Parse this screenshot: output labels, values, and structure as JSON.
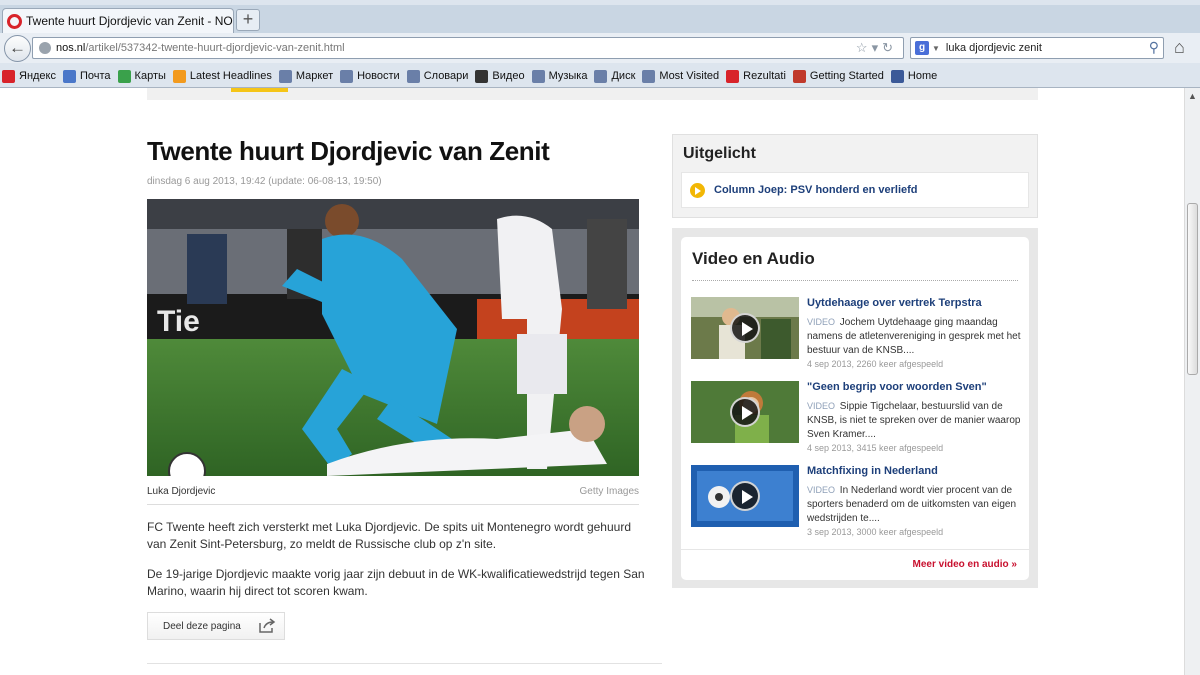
{
  "browser": {
    "tab_title": "Twente huurt Djordjevic van Zenit - NOS Sport",
    "new_tab": "+",
    "url_domain": "nos.nl",
    "url_path": "/artikel/537342-twente-huurt-djordjevic-van-zenit.html",
    "search_engine": "g",
    "search_query": "luka djordjevic zenit",
    "bookmarks": [
      {
        "label": "Яндекс",
        "icon": "yandex-icon",
        "color": "#d8232a"
      },
      {
        "label": "Почта",
        "icon": "mail-icon",
        "color": "#4a77c9"
      },
      {
        "label": "Карты",
        "icon": "maps-icon",
        "color": "#3aa14b"
      },
      {
        "label": "Latest Headlines",
        "icon": "rss-icon",
        "color": "#f29a1e"
      },
      {
        "label": "Маркет",
        "icon": "market-icon",
        "color": "#6a7fa8"
      },
      {
        "label": "Новости",
        "icon": "news-icon",
        "color": "#6a7fa8"
      },
      {
        "label": "Словари",
        "icon": "dictionary-icon",
        "color": "#6a7fa8"
      },
      {
        "label": "Видео",
        "icon": "video-icon",
        "color": "#333333"
      },
      {
        "label": "Музыка",
        "icon": "music-icon",
        "color": "#6a7fa8"
      },
      {
        "label": "Диск",
        "icon": "disk-icon",
        "color": "#6a7fa8"
      },
      {
        "label": "Most Visited",
        "icon": "most-visited-icon",
        "color": "#6a7fa8"
      },
      {
        "label": "Rezultati",
        "icon": "rezultati-icon",
        "color": "#d8232a"
      },
      {
        "label": "Getting Started",
        "icon": "firefox-icon",
        "color": "#c0392b"
      },
      {
        "label": "Home",
        "icon": "facebook-icon",
        "color": "#3b5998"
      }
    ]
  },
  "article": {
    "headline": "Twente huurt Djordjevic van Zenit",
    "dateline": "dinsdag 6 aug 2013, 19:42 (update: 06-08-13, 19:50)",
    "caption": "Luka Djordjevic",
    "credit": "Getty Images",
    "paragraph1": "FC Twente heeft zich versterkt met Luka Djordjevic. De spits uit Montenegro wordt gehuurd van Zenit Sint-Petersburg, zo meldt de Russische club op z'n site.",
    "paragraph2": "De 19-jarige Djordjevic maakte vorig jaar zijn debuut in de WK-kwalificatiewedstrijd tegen San Marino, waarin hij direct tot scoren kwam.",
    "share_label": "Deel deze pagina"
  },
  "sidebar": {
    "featured_title": "Uitgelicht",
    "featured_link": "Column Joep: PSV honderd en verliefd",
    "video_title": "Video en Audio",
    "videos": [
      {
        "title": "Uytdehaage over vertrek Terpstra",
        "tag": "VIDEO",
        "desc": "Jochem Uytdehaage ging maandag namens de atletenvereniging in gesprek met het bestuur van de KNSB....",
        "meta": "4 sep 2013, 2260 keer afgespeeld"
      },
      {
        "title": "\"Geen begrip voor woorden Sven\"",
        "tag": "VIDEO",
        "desc": "Sippie Tigchelaar, bestuurslid van de KNSB, is niet te spreken over de manier waarop Sven Kramer....",
        "meta": "4 sep 2013, 3415 keer afgespeeld"
      },
      {
        "title": "Matchfixing in Nederland",
        "tag": "VIDEO",
        "desc": "In Nederland wordt vier procent van de sporters benaderd om de uitkomsten van eigen wedstrijden te....",
        "meta": "3 sep 2013, 3000 keer afgespeeld"
      }
    ],
    "more_link": "Meer video en audio »"
  },
  "colors": {
    "link_blue": "#1d3f7a",
    "accent_red": "#c8102e",
    "accent_yellow": "#f2b705"
  }
}
